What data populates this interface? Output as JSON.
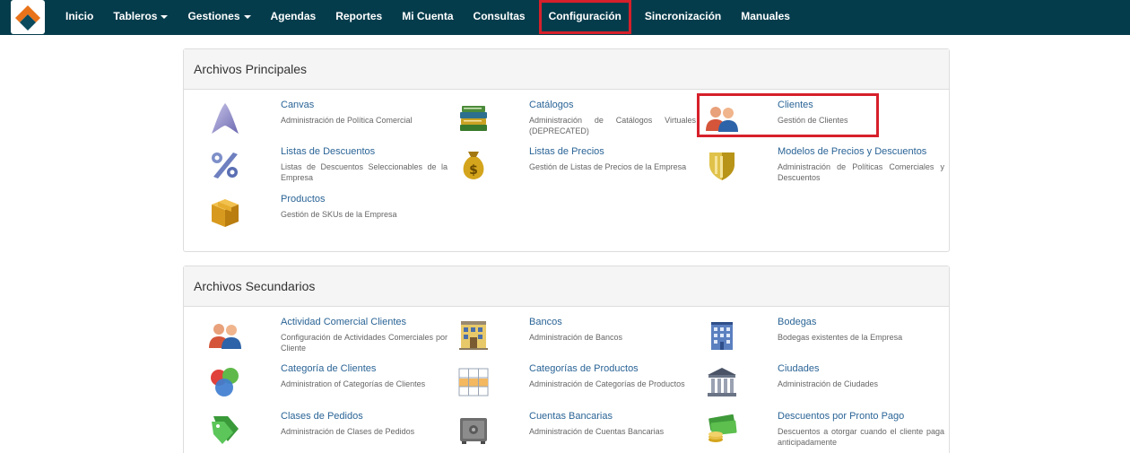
{
  "navbar": {
    "items": [
      {
        "label": "Inicio"
      },
      {
        "label": "Tableros",
        "dropdown": true
      },
      {
        "label": "Gestiones",
        "dropdown": true
      },
      {
        "label": "Agendas"
      },
      {
        "label": "Reportes"
      },
      {
        "label": "Mi Cuenta"
      },
      {
        "label": "Consultas"
      },
      {
        "label": "Configuración",
        "highlighted": true
      },
      {
        "label": "Sincronización"
      },
      {
        "label": "Manuales"
      }
    ]
  },
  "principales": {
    "heading": "Archivos Principales",
    "items": [
      {
        "title": "Canvas",
        "desc": "Administración de Política Comercial",
        "icon": "canvas-icon"
      },
      {
        "title": "Catálogos",
        "desc": "Administración de Catálogos Virtuales (DEPRECATED)",
        "icon": "books-icon"
      },
      {
        "title": "Clientes",
        "desc": "Gestión de Clientes",
        "icon": "users-icon",
        "highlighted": true
      },
      {
        "title": "Listas de Descuentos",
        "desc": "Listas de Descuentos Seleccionables de la Empresa",
        "icon": "percent-icon"
      },
      {
        "title": "Listas de Precios",
        "desc": "Gestión de Listas de Precios de la Empresa",
        "icon": "money-bag-icon"
      },
      {
        "title": "Modelos de Precios y Descuentos",
        "desc": "Administración de Políticas Comerciales y Descuentos",
        "icon": "shield-icon"
      },
      {
        "title": "Productos",
        "desc": "Gestión de SKUs de la Empresa",
        "icon": "box-icon"
      }
    ]
  },
  "secundarios": {
    "heading": "Archivos Secundarios",
    "items": [
      {
        "title": "Actividad Comercial Clientes",
        "desc": "Configuración de Actividades Comerciales por Cliente",
        "icon": "users-icon"
      },
      {
        "title": "Bancos",
        "desc": "Administración de Bancos",
        "icon": "bank-building-icon"
      },
      {
        "title": "Bodegas",
        "desc": "Bodegas existentes de la Empresa",
        "icon": "warehouse-icon"
      },
      {
        "title": "Categoría de Clientes",
        "desc": "Administration of Categorías de Clientes",
        "icon": "circles-icon"
      },
      {
        "title": "Categorías de Productos",
        "desc": "Administración de Categorías de Productos",
        "icon": "table-icon"
      },
      {
        "title": "Ciudades",
        "desc": "Administración de Ciudades",
        "icon": "columns-building-icon"
      },
      {
        "title": "Clases de Pedidos",
        "desc": "Administración de Clases de Pedidos",
        "icon": "tags-icon"
      },
      {
        "title": "Cuentas Bancarias",
        "desc": "Administración de Cuentas Bancarias",
        "icon": "safe-icon"
      },
      {
        "title": "Descuentos por Pronto Pago",
        "desc": "Descuentos a otorgar cuando el cliente paga anticipadamente",
        "icon": "cash-icon"
      }
    ]
  }
}
